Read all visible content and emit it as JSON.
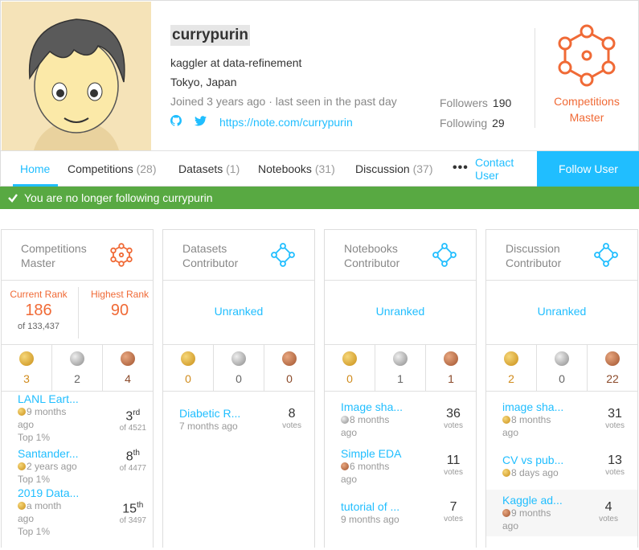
{
  "profile": {
    "username": "currypurin",
    "bio": "kaggler at data-refinement",
    "location": "Tokyo, Japan",
    "joined": "Joined 3 years ago · last seen in the past day",
    "url": "https://note.com/currypurin",
    "followers_label": "Followers",
    "followers": "190",
    "following_label": "Following",
    "following": "29",
    "tier_line1": "Competitions",
    "tier_line2": "Master"
  },
  "tabs": [
    {
      "label": "Home",
      "count": ""
    },
    {
      "label": "Competitions",
      "count": "(28)"
    },
    {
      "label": "Datasets",
      "count": "(1)"
    },
    {
      "label": "Notebooks",
      "count": "(31)"
    },
    {
      "label": "Discussion",
      "count": "(37)"
    }
  ],
  "more": "•••",
  "contact": {
    "l1": "Contact",
    "l2": "User"
  },
  "follow_button": "Follow User",
  "toast": "You are no longer following currypurin",
  "colors": {
    "accent": "#20beff",
    "master": "#f06a36",
    "success": "#58a942"
  },
  "cards": [
    {
      "t1": "Competitions",
      "t2": "Master",
      "current_rank_label": "Current Rank",
      "current_rank": "186",
      "of_total": "of 133,437",
      "highest_rank_label": "Highest Rank",
      "highest_rank": "90",
      "medals": [
        "3",
        "2",
        "4"
      ],
      "items": [
        {
          "title": "LANL Eart...",
          "meta1": "9 months",
          "meta2": "ago",
          "meta3": "Top 1%",
          "place": "3",
          "suffix": "rd",
          "of": "of 4521"
        },
        {
          "title": "Santander...",
          "meta1": "2 years ago",
          "meta2": "",
          "meta3": "Top 1%",
          "place": "8",
          "suffix": "th",
          "of": "of 4477"
        },
        {
          "title": "2019 Data...",
          "meta1": "a month",
          "meta2": "ago",
          "meta3": "Top 1%",
          "place": "15",
          "suffix": "th",
          "of": "of 3497"
        }
      ]
    },
    {
      "t1": "Datasets",
      "t2": "Contributor",
      "rank": "Unranked",
      "medals": [
        "0",
        "0",
        "0"
      ],
      "items": [
        {
          "title": "Diabetic R...",
          "meta1": "7 months ago",
          "votes": "8",
          "votes_label": "votes"
        }
      ]
    },
    {
      "t1": "Notebooks",
      "t2": "Contributor",
      "rank": "Unranked",
      "medals": [
        "0",
        "1",
        "1"
      ],
      "items": [
        {
          "title": "Image sha...",
          "meta1": "8 months",
          "meta2": "ago",
          "votes": "36",
          "votes_label": "votes"
        },
        {
          "title": "Simple EDA",
          "meta1": "6 months",
          "meta2": "ago",
          "votes": "11",
          "votes_label": "votes"
        },
        {
          "title": "tutorial of ...",
          "meta1": "9 months ago",
          "votes": "7",
          "votes_label": "votes"
        }
      ]
    },
    {
      "t1": "Discussion",
      "t2": "Contributor",
      "rank": "Unranked",
      "medals": [
        "2",
        "0",
        "22"
      ],
      "items": [
        {
          "title": "image sha...",
          "meta1": "8 months",
          "meta2": "ago",
          "votes": "31",
          "votes_label": "votes"
        },
        {
          "title": "CV vs pub...",
          "meta1": "8 days ago",
          "votes": "13",
          "votes_label": "votes"
        },
        {
          "title": "Kaggle ad...",
          "meta1": "9 months",
          "meta2": "ago",
          "votes": "4",
          "votes_label": "votes"
        }
      ]
    }
  ]
}
